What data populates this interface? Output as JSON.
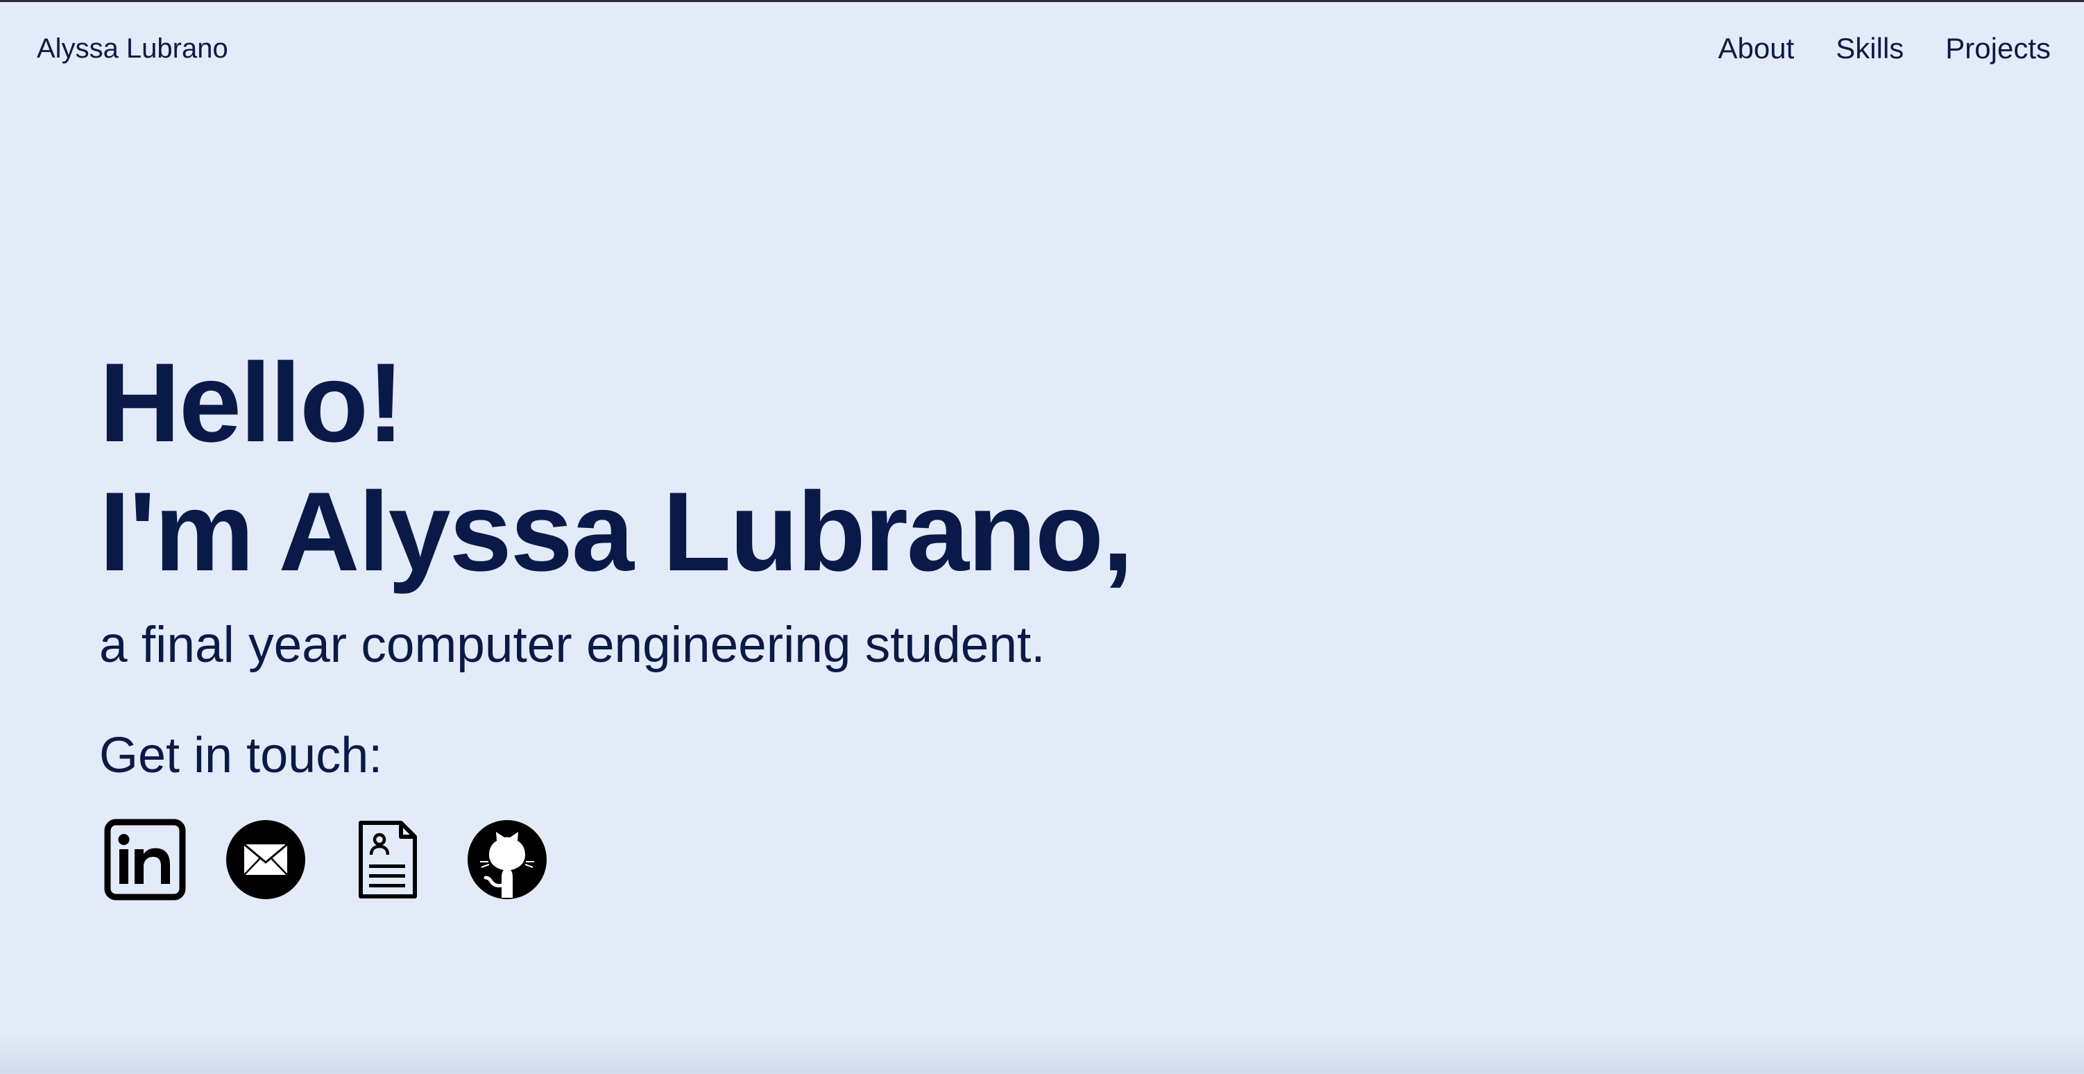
{
  "nav": {
    "brand": "Alyssa Lubrano",
    "links": [
      {
        "label": "About"
      },
      {
        "label": "Skills"
      },
      {
        "label": "Projects"
      }
    ]
  },
  "hero": {
    "greeting": "Hello!",
    "intro": "I'm Alyssa Lubrano,",
    "subtitle": "a final year computer engineering student.",
    "contact_label": "Get in touch:"
  },
  "contact_icons": [
    {
      "icon": "linkedin-icon"
    },
    {
      "icon": "email-icon"
    },
    {
      "icon": "resume-icon"
    },
    {
      "icon": "github-icon"
    }
  ],
  "colors": {
    "background": "#e3ebf9",
    "text": "#0b1a45",
    "icon": "#000000"
  }
}
